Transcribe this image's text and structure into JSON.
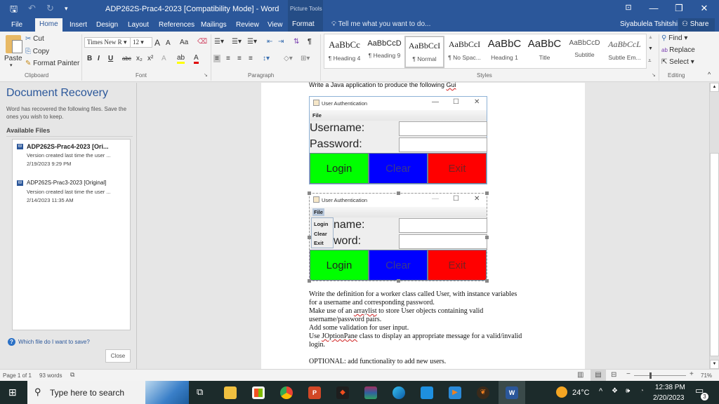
{
  "window": {
    "title": "ADP262S-Prac4-2023 [Compatibility Mode] - Word",
    "contextual_group": "Picture Tools",
    "qat": {
      "save": "save-icon",
      "undo": "undo-icon",
      "redo": "redo-icon",
      "customize": "customize-icon"
    },
    "controls": {
      "ribbon_display": "⊡",
      "minimize": "—",
      "restore": "❐",
      "close": "✕"
    }
  },
  "tabs": [
    {
      "label": "File"
    },
    {
      "label": "Home",
      "active": true
    },
    {
      "label": "Insert"
    },
    {
      "label": "Design"
    },
    {
      "label": "Layout"
    },
    {
      "label": "References"
    },
    {
      "label": "Mailings"
    },
    {
      "label": "Review"
    },
    {
      "label": "View"
    },
    {
      "label": "Format"
    }
  ],
  "tell_me": "Tell me what you want to do...",
  "user": {
    "name": "Siyabulela Tshitshi",
    "share_label": "Share"
  },
  "ribbon": {
    "clipboard": {
      "paste": "Paste",
      "cut": "Cut",
      "copy": "Copy",
      "format_painter": "Format Painter",
      "label": "Clipboard"
    },
    "font": {
      "name": "Times New R",
      "size": "12",
      "grow": "A",
      "shrink": "A",
      "case": "Aa",
      "bold": "B",
      "italic": "I",
      "underline": "U",
      "strike": "abc",
      "sub": "x₂",
      "sup": "x²",
      "label": "Font"
    },
    "paragraph": {
      "label": "Paragraph"
    },
    "styles": {
      "label": "Styles",
      "items": [
        {
          "preview": "AaBbCc",
          "name": "¶ Heading 4"
        },
        {
          "preview": "AaBbCcD",
          "name": "¶ Heading 9"
        },
        {
          "preview": "AaBbCcI",
          "name": "¶ Normal",
          "selected": true
        },
        {
          "preview": "AaBbCcI",
          "name": "¶ No Spac..."
        },
        {
          "preview": "AaBbC",
          "name": "Heading 1"
        },
        {
          "preview": "AaBbC",
          "name": "Title"
        },
        {
          "preview": "AaBbCcD",
          "name": "Subtitle"
        },
        {
          "preview": "AaBbCcL",
          "name": "Subtle Em..."
        }
      ]
    },
    "editing": {
      "find": "Find",
      "replace": "Replace",
      "select": "Select",
      "label": "Editing"
    }
  },
  "recovery": {
    "title": "Document Recovery",
    "description": "Word has recovered the following files.  Save the ones you wish to keep.",
    "available_label": "Available Files",
    "files": [
      {
        "name": "ADP262S-Prac4-2023  [Ori...",
        "desc": "Version created last time the user ...",
        "date": "2/19/2023 9:29 PM"
      },
      {
        "name": "ADP262S-Prac3-2023  [Original]",
        "desc": "Version created last time the user ...",
        "date": "2/14/2023 11:35 AM"
      }
    ],
    "help_link": "Which file do I want to save?",
    "close_label": "Close"
  },
  "document": {
    "intro_line": "Write a Java application to produce the following ",
    "intro_word": "Gui",
    "java_window_1": {
      "title": "User Authentication",
      "menu": "File",
      "username_label": "Username:",
      "password_label": "Password:",
      "buttons": [
        {
          "label": "Login",
          "bg": "#00ff00"
        },
        {
          "label": "Clear",
          "bg": "#0000ff"
        },
        {
          "label": "Exit",
          "bg": "#ff0000"
        }
      ]
    },
    "java_window_2": {
      "title": "User Authentication",
      "menu": "File",
      "menu_items": [
        "Login",
        "Clear",
        "Exit"
      ],
      "username_label": "name:",
      "password_label": "word:",
      "buttons": [
        {
          "label": "Login",
          "bg": "#00ff00"
        },
        {
          "label": "Clear",
          "bg": "#0000ff"
        },
        {
          "label": "Exit",
          "bg": "#ff0000"
        }
      ]
    },
    "paragraphs": [
      "Write the definition for a worker class called User, with instance variables",
      "for a username and corresponding password.",
      "Make use of an ",
      "arraylist",
      " to store User objects containing valid",
      "username/password pairs.",
      "Add some validation for user input.",
      "Use ",
      "JOptionPane",
      " class to display an appropriate message for a valid/invalid",
      "login.",
      "OPTIONAL: add functionality to add new users."
    ]
  },
  "status": {
    "page": "Page 1 of 1",
    "words": "93 words",
    "zoom": "71%",
    "zoom_value_percent": 71
  },
  "taskbar": {
    "search_placeholder": "Type here to search",
    "weather": "24°C",
    "time": "12:38 PM",
    "date": "2/20/2023",
    "notifications": "3",
    "apps": [
      "task-view",
      "file-explorer",
      "microsoft-store",
      "chrome",
      "powerpoint",
      "figma",
      "winrar",
      "edge",
      "mail",
      "media-player",
      "fl-studio",
      "word"
    ]
  },
  "colors": {
    "word_blue": "#2b579a",
    "green": "#00ff00",
    "blue": "#0000ff",
    "red": "#ff0000"
  }
}
